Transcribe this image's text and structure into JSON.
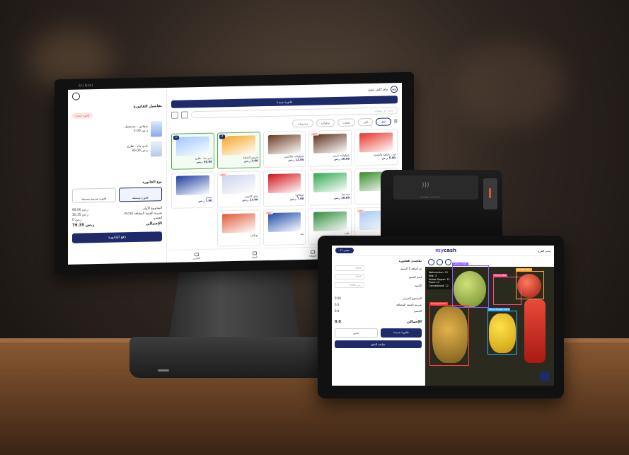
{
  "monitor": {
    "brand": "SUNMI",
    "invoice": {
      "title": "تفاصيل الفاتورة",
      "new_invoice_label": "فاتورة جديدة",
      "items": [
        {
          "name": "سيلاس - مستعمل",
          "detail": "2.00 ر.س",
          "qty": "2"
        },
        {
          "name": "نادي ماء - طازج",
          "detail": "30.00 ر.س",
          "qty": "1"
        }
      ],
      "type_label": "نوع الفاتورة",
      "type_options": [
        "فاتورة مبسطة",
        "فاتورة ضريبية مبسطة"
      ],
      "totals": [
        {
          "label": "المجموع الأولى",
          "value": "69.00 ر.س"
        },
        {
          "label": "ضريبة القيمة المضافة (15%)",
          "value": "10.35 ر.س"
        },
        {
          "label": "الخصم",
          "value": "0 ر.س"
        }
      ],
      "grand_label": "الإجمالي",
      "grand_value": "79.35 ر.س",
      "pay_label": "دفع الفاتورة"
    },
    "products": {
      "store_name": "ماي كاش سون",
      "bar_label": "فاتورة جديدة",
      "search_placeholder": "ابحث عن منتجات",
      "categories": [
        "الكل",
        "ألبان",
        "معلبات",
        "شكولاتة",
        "مشروبات"
      ],
      "items": [
        {
          "name": "ليز - بالنكهة والليمون",
          "price": "5.00 ر.س",
          "badge": "",
          "qty": "",
          "color": "#e8332a",
          "sel": false
        },
        {
          "name": "شوكولاتة مارس",
          "price": "10.00 ر.س",
          "badge": "-10%",
          "qty": "",
          "color": "#5a2f1a",
          "sel": false
        },
        {
          "name": "شوكولاتة جالاكسي",
          "price": "12.00 ر.س",
          "badge": "",
          "qty": "",
          "color": "#6b3b22",
          "sel": false
        },
        {
          "name": "شيبس الشطة",
          "price": "3.00 ر.س",
          "badge": "-30%",
          "qty": "x1",
          "color": "#f5a623",
          "sel": true
        },
        {
          "name": "نادي ماء - طازج",
          "price": "30.00 ر.س",
          "badge": "",
          "qty": "x2",
          "color": "#9ec6ff",
          "sel": true
        },
        {
          "name": "شيبس",
          "price": "6.00 ر.س",
          "badge": "",
          "qty": "",
          "color": "#3a8b2a",
          "sel": false
        },
        {
          "name": "حبة فيتا",
          "price": "10.00 ر.س",
          "badge": "",
          "qty": "",
          "color": "#2fa84f",
          "sel": false
        },
        {
          "name": "كوكاكولا",
          "price": "7.00 ر.س",
          "badge": "",
          "qty": "",
          "color": "#d0121b",
          "sel": false
        },
        {
          "name": "شاي الكيوبي",
          "price": "13.00 ر.س",
          "badge": "-30%",
          "qty": "",
          "color": "#c9d3ea",
          "sel": false
        },
        {
          "name": "بيبسي",
          "price": "7.00 ر.س",
          "badge": "",
          "qty": "",
          "color": "#1d3fa0",
          "sel": false
        },
        {
          "name": "نيدو",
          "price": "",
          "badge": "-10%",
          "qty": "",
          "color": "#a9c7f0",
          "sel": false
        },
        {
          "name": "حليب",
          "price": "",
          "badge": "",
          "qty": "",
          "color": "#2d8a3a",
          "sel": false
        },
        {
          "name": "تايد",
          "price": "",
          "badge": "-10%",
          "qty": "",
          "color": "#1f4aa8",
          "sel": false
        },
        {
          "name": "بونكس",
          "price": "",
          "badge": "",
          "qty": "",
          "color": "#e05a3a",
          "sel": false
        }
      ],
      "tabs": [
        "المبيعات",
        "العملاء",
        "المواد",
        "التقارير"
      ]
    }
  },
  "printer": {
    "model": "SUNMI V2 PRO"
  },
  "tablet": {
    "logo_prefix": "my",
    "logo_suffix": "cash",
    "pill_label": "17 عنصر",
    "user_label": "مدير الفرع",
    "invoice_title": "تفاصيل الفاتورة",
    "rows": [
      {
        "label": "تم إضافة 1 الصنف",
        "value": "2000"
      },
      {
        "label": "اسم المنتج",
        "value": "2000"
      },
      {
        "label": "الكمية",
        "value": "3000 ر.س"
      }
    ],
    "summary": [
      {
        "label": "المجموع الجزئي",
        "value": "0.00"
      },
      {
        "label": "ضريبة القيمة المضافة",
        "value": "0.0"
      },
      {
        "label": "الخصم",
        "value": "0.0"
      }
    ],
    "total_label": "الإجمالي",
    "total_value": "0.0",
    "btn_new": "فاتورة جديدة",
    "btn_hold": "تعليق",
    "btn_pay": "متابعة الدفع",
    "detections": [
      "Lettuce 99%",
      "Onion 98%",
      "Yellow Pepper 92%",
      "Pineapple 94%",
      "Tomato 96%"
    ],
    "info_lines": [
      "Watermelon: 12",
      "Milk: 3",
      "Yellow Pepper: 12",
      "Pizza: 12",
      "Cannabinoid: 12"
    ]
  }
}
